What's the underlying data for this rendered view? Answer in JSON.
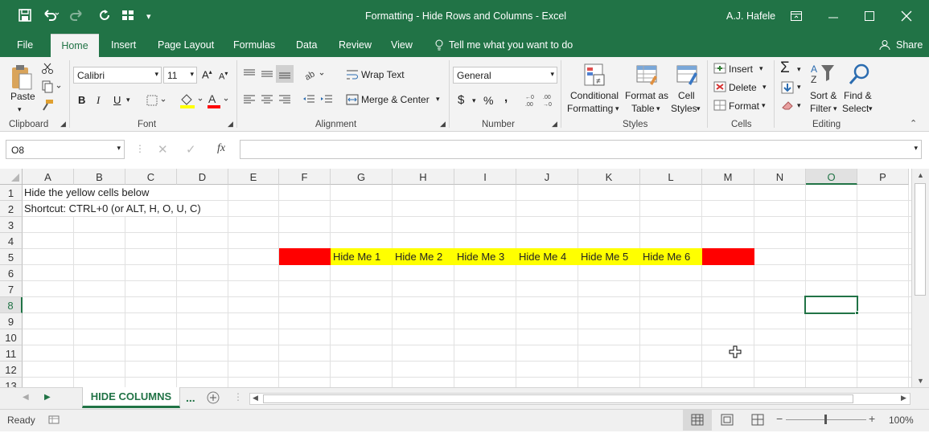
{
  "window": {
    "title": "Formatting - Hide Rows and Columns  -  Excel",
    "user": "A.J. Hafele"
  },
  "tabs": [
    "File",
    "Home",
    "Insert",
    "Page Layout",
    "Formulas",
    "Data",
    "Review",
    "View"
  ],
  "tell_me": "Tell me what you want to do",
  "share": "Share",
  "ribbon": {
    "clipboard": {
      "label": "Clipboard",
      "paste": "Paste"
    },
    "font": {
      "label": "Font",
      "name": "Calibri",
      "size": "11",
      "bold": "B",
      "italic": "I",
      "underline": "U"
    },
    "alignment": {
      "label": "Alignment",
      "wrap": "Wrap Text",
      "merge": "Merge & Center"
    },
    "number": {
      "label": "Number",
      "format": "General",
      "currency": "$",
      "percent": "%",
      "comma": ","
    },
    "styles": {
      "label": "Styles",
      "cond1": "Conditional",
      "cond2": "Formatting",
      "fmt1": "Format as",
      "fmt2": "Table",
      "cell1": "Cell",
      "cell2": "Styles"
    },
    "cells": {
      "label": "Cells",
      "insert": "Insert",
      "delete": "Delete",
      "format": "Format"
    },
    "editing": {
      "label": "Editing",
      "sort1": "Sort &",
      "sort2": "Filter",
      "find1": "Find &",
      "find2": "Select"
    }
  },
  "formula_bar": {
    "name_box": "O8",
    "fx": "fx",
    "value": ""
  },
  "columns": [
    "A",
    "B",
    "C",
    "D",
    "E",
    "F",
    "G",
    "H",
    "I",
    "J",
    "K",
    "L",
    "M",
    "N",
    "O",
    "P"
  ],
  "rows": [
    "1",
    "2",
    "3",
    "4",
    "5",
    "6",
    "7",
    "8",
    "9",
    "10",
    "11",
    "12",
    "13"
  ],
  "cells": {
    "a1": "Hide the yellow cells below",
    "a2": "Shortcut: CTRL+0 (or ALT, H, O, U, C)",
    "g5": "Hide Me 1",
    "h5": "Hide Me 2",
    "i5": "Hide Me 3",
    "j5": "Hide Me 4",
    "k5": "Hide Me 5",
    "l5": "Hide Me 6"
  },
  "colors": {
    "excel_green": "#217346",
    "red_fill": "#ff0000",
    "yellow_fill": "#ffff00"
  },
  "sheet_tabs": {
    "active": "HIDE COLUMNS",
    "more": "..."
  },
  "status": {
    "ready": "Ready",
    "zoom": "100%"
  }
}
